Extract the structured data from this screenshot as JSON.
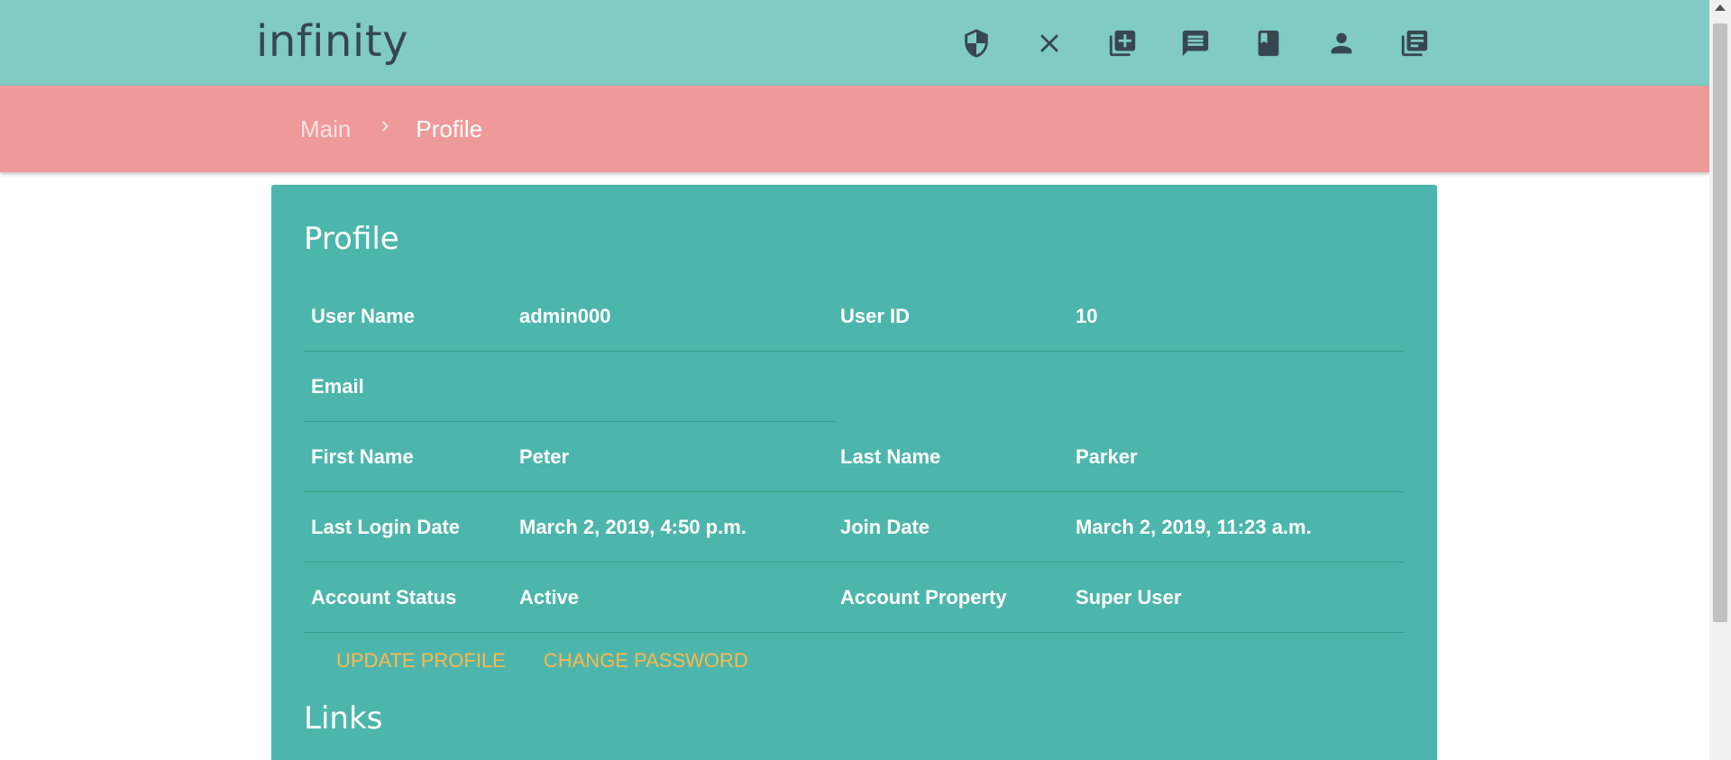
{
  "brand": "infinity",
  "top_icons": [
    "shield-icon",
    "close-icon",
    "library-add-icon",
    "comment-icon",
    "book-icon",
    "person-icon",
    "library-books-icon"
  ],
  "breadcrumb": {
    "main": "Main",
    "current": "Profile"
  },
  "card": {
    "title": "Profile",
    "fields": {
      "username_label": "User Name",
      "username_value": "admin000",
      "userid_label": "User ID",
      "userid_value": "10",
      "email_label": "Email",
      "email_value": "",
      "firstname_label": "First Name",
      "firstname_value": "Peter",
      "lastname_label": "Last Name",
      "lastname_value": "Parker",
      "lastlogin_label": "Last Login Date",
      "lastlogin_value": "March 2, 2019, 4:50 p.m.",
      "joindate_label": "Join Date",
      "joindate_value": "March 2, 2019, 11:23 a.m.",
      "status_label": "Account Status",
      "status_value": "Active",
      "property_label": "Account Property",
      "property_value": "Super User"
    },
    "actions": {
      "update": "UPDATE PROFILE",
      "change_password": "CHANGE PASSWORD"
    },
    "links_title": "Links"
  },
  "colors": {
    "topbar": "#80cbc4",
    "crumbbar": "#ef9a9a",
    "card": "#4db6ac",
    "action": "#ffb74d"
  }
}
